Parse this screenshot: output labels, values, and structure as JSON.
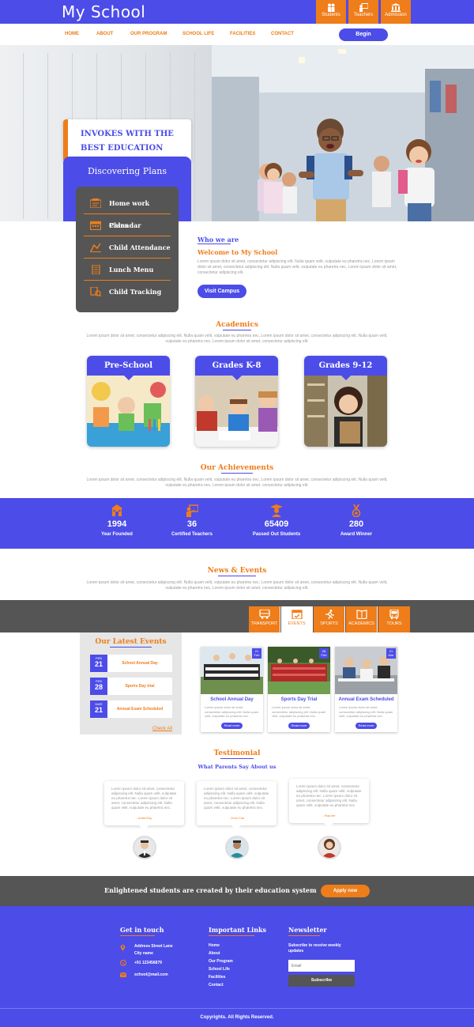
{
  "header": {
    "logo": "My School",
    "top_tabs": [
      {
        "label": "Students",
        "icon": "students-icon"
      },
      {
        "label": "Teachers",
        "icon": "teachers-icon"
      },
      {
        "label": "Admission",
        "icon": "admission-icon"
      }
    ]
  },
  "nav": {
    "items": [
      "HOME",
      "ABOUT",
      "OUR PROGRAM",
      "SCHOOL LIFE",
      "FACILITIES",
      "CONTACT"
    ],
    "begin_label": "Begin"
  },
  "hero": {
    "headline_line1": "INVOKES WITH THE",
    "headline_line2": "BEST EDUCATION SYSTEM"
  },
  "plans": {
    "title": "Discovering Plans",
    "items": [
      {
        "label": "Home work Plans",
        "icon": "homework-icon"
      },
      {
        "label": "Calendar",
        "icon": "calendar-icon"
      },
      {
        "label": "Child Attendance",
        "icon": "attendance-icon"
      },
      {
        "label": "Lunch Menu",
        "icon": "lunch-menu-icon"
      },
      {
        "label": "Child Tracking",
        "icon": "tracking-icon"
      }
    ]
  },
  "who": {
    "title": "Who we are",
    "subtitle": "Welcome to My School",
    "text": "Lorem ipsum dolor sit amet, consectetur adipiscing elit. Nulla quam velit, vulputate eu pharetra nec, Lorem ipsum dolor sit amet, consectetur adipiscing elit. Nulla quam velit, vulputate eu pharetra nec, Lorem ipsum dolor sit amet, consectetur adipiscing elit.",
    "button": "Visit Campus"
  },
  "academics": {
    "title": "Academics",
    "text": "Lorem ipsum dolor sit amet, consectetur adipiscing elit. Nulla quam velit, vulputate eu pharetra nec, Lorem ipsum dolor sit amet, consectetur adipiscing elit. Nulla quam velit, vulputate eu pharetra nec, Lorem ipsum dolor sit amet, consectetur adipiscing elit.",
    "cards": [
      "Pre-School",
      "Grades K-8",
      "Grades 9-12"
    ]
  },
  "achievements": {
    "title": "Our Achievements",
    "text": "Lorem ipsum dolor sit amet, consectetur adipiscing elit. Nulla quam velit, vulputate eu pharetra nec, Lorem ipsum dolor sit amet, consectetur adipiscing elit. Nulla quam velit, vulputate eu pharetra nec, Lorem ipsum dolor sit amet, consectetur adipiscing elit.",
    "stats": [
      {
        "value": "1994",
        "label": "Year Founded",
        "icon": "school-building-icon"
      },
      {
        "value": "36",
        "label": "Certified Teachers",
        "icon": "teacher-board-icon"
      },
      {
        "value": "65409",
        "label": "Passed Out Students",
        "icon": "graduate-icon"
      },
      {
        "value": "280",
        "label": "Award Winner",
        "icon": "medal-icon"
      }
    ]
  },
  "news": {
    "title": "News & Events",
    "text": "Lorem ipsum dolor sit amet, consectetur adipiscing elit. Nulla quam velit, vulputate eu pharetra nec, Lorem ipsum dolor sit amet, consectetur adipiscing elit. Nulla quam velit, vulputate eu pharetra nec, Lorem ipsum dolor sit amet, consectetur adipiscing elit.",
    "tabs": [
      {
        "label": "TRANSPORT",
        "icon": "bus-icon"
      },
      {
        "label": "EVENTS",
        "icon": "calendar-check-icon"
      },
      {
        "label": "SPORTS",
        "icon": "runner-icon"
      },
      {
        "label": "ACADEMICS",
        "icon": "book-icon"
      },
      {
        "label": "TOURS",
        "icon": "bus-front-icon"
      }
    ],
    "latest_title": "Our Latest Events",
    "latest": [
      {
        "month": "FEB",
        "day": "21",
        "name": "School Annual Day"
      },
      {
        "month": "FEB",
        "day": "28",
        "name": "Sports Day trial"
      },
      {
        "month": "MAR",
        "day": "21",
        "name": "Annual Exam Scheduled"
      }
    ],
    "check_all": "Check All",
    "cards": [
      {
        "badge_day": "21",
        "badge_month": "Feb",
        "title": "School Annual Day",
        "text": "Lorem ipsum dolor sit amet, consectetur adipiscing elit. Nulla quam velit, vulputate eu pharetra nec.",
        "button": "Read more"
      },
      {
        "badge_day": "28",
        "badge_month": "Feb",
        "title": "Sports Day Trial",
        "text": "Lorem ipsum dolor sit amet, consectetur adipiscing elit. Nulla quam velit, vulputate eu pharetra nec.",
        "button": "Read more"
      },
      {
        "badge_day": "21",
        "badge_month": "Mar",
        "title": "Annual Exam Scheduled",
        "text": "Lorem ipsum dolor sit amet, consectetur adipiscing elit. Nulla quam velit, vulputate eu pharetra nec.",
        "button": "Read more"
      }
    ]
  },
  "testimonial": {
    "title": "Testimonial",
    "subtitle": "What Parents Say About us",
    "items": [
      {
        "text": "Lorem ipsum dolor sit amet, consectetur adipiscing elit. Nulla quam velit, vulputate eu pharetra nec. Lorem ipsum dolor sit amet, consectetur adipiscing elit. Nulla quam velit, vulputate eu pharetra nec.",
        "name": "- Anita Roy"
      },
      {
        "text": "Lorem ipsum dolor sit amet, consectetur adipiscing elit. Nulla quam velit, vulputate eu pharetra nec. Lorem ipsum dolor sit amet, consectetur adipiscing elit. Nulla quam velit, vulputate eu pharetra nec.",
        "name": "- John Cas"
      },
      {
        "text": "Lorem ipsum dolor sit amet, consectetur adipiscing elit. Nulla quam velit, vulputate eu pharetra nec. Lorem ipsum dolor sit amet, consectetur adipiscing elit. Nulla quam velit, vulputate eu pharetra nec.",
        "name": "- Ray lee"
      }
    ]
  },
  "cta": {
    "text": "Enlightened students are created by their education system",
    "button": "Apply now"
  },
  "footer": {
    "touch_title": "Get in touch",
    "address_line1": "Address Street Lane",
    "address_line2": "City name",
    "phone": "+91 123456879",
    "email": "school@mail.com",
    "links_title": "Important Links",
    "links": [
      "Home",
      "About",
      "Our Program",
      "School Life",
      "Facilities",
      "Contact"
    ],
    "news_title": "Newsletter",
    "news_text": "Subscribe to receive weekly updates",
    "email_placeholder": "Email",
    "subscribe": "Subscribe",
    "copyright": "Copyrights. All Rights Reserved."
  },
  "colors": {
    "primary": "#4c4ce8",
    "accent": "#ee7d1a",
    "dark": "#555555"
  }
}
